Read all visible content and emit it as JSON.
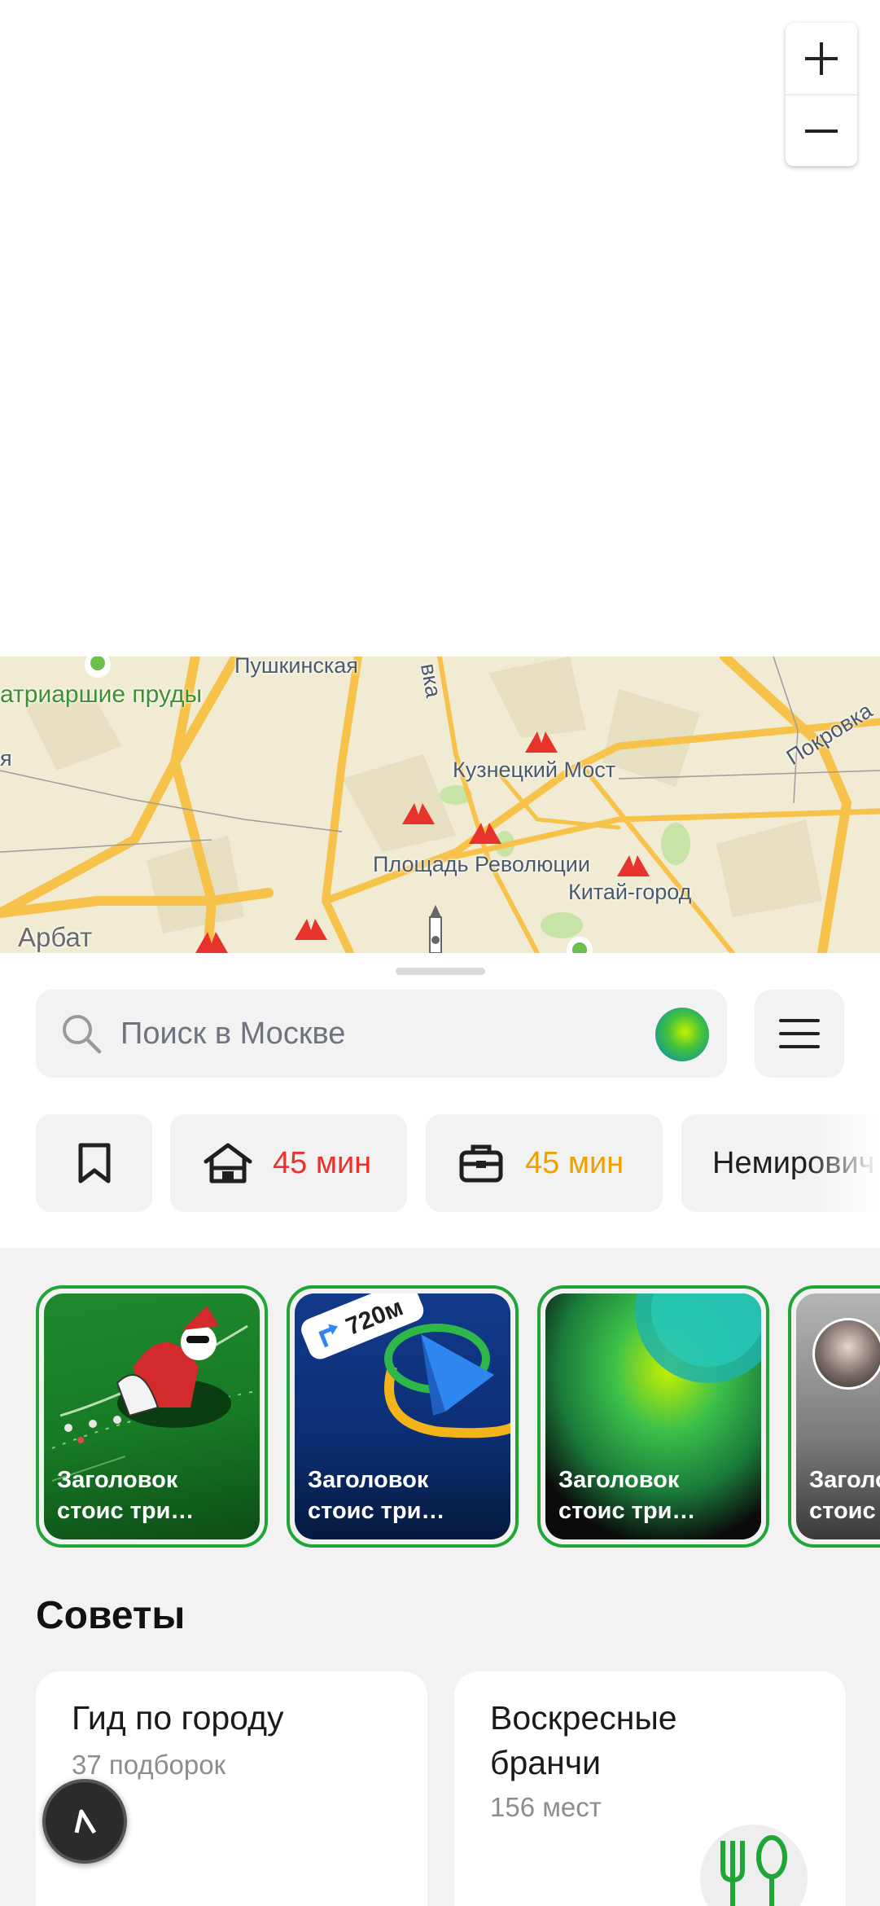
{
  "map": {
    "labels": [
      "Пушкинская",
      "атриаршие пруды",
      "вка",
      "Кузнецкий Мост",
      "Покровка",
      "Площадь Революции",
      "Китай-город",
      "Арбат",
      "я"
    ]
  },
  "zoom": {
    "in_icon": "plus-icon",
    "out_icon": "minus-icon"
  },
  "search": {
    "placeholder": "Поиск в Москве",
    "assistant_icon": "alice-assistant-icon"
  },
  "chips": [
    {
      "label": "",
      "icon": "bookmark-icon"
    },
    {
      "label": "45 мин",
      "icon": "home-icon",
      "color": "#e8322c"
    },
    {
      "label": "45 мин",
      "icon": "briefcase-icon",
      "color": "#f0a000"
    },
    {
      "label": "Немирович",
      "icon": ""
    }
  ],
  "stories": [
    {
      "title": "Заголовок стоис три…"
    },
    {
      "title": "Заголовок стоис три…",
      "badge": "720м"
    },
    {
      "title": "Заголовок стоис три…"
    },
    {
      "title": "Заголовок стоис три…"
    }
  ],
  "tips": {
    "title": "Советы",
    "cards": [
      {
        "title": "Гид по городу",
        "subtitle": "37 подборок"
      },
      {
        "title": "Воскресные бранчи",
        "subtitle": "156 мест"
      }
    ]
  },
  "colors": {
    "accent_green": "#1fa637",
    "metro_red": "#e8322c",
    "orange": "#f0a000"
  }
}
